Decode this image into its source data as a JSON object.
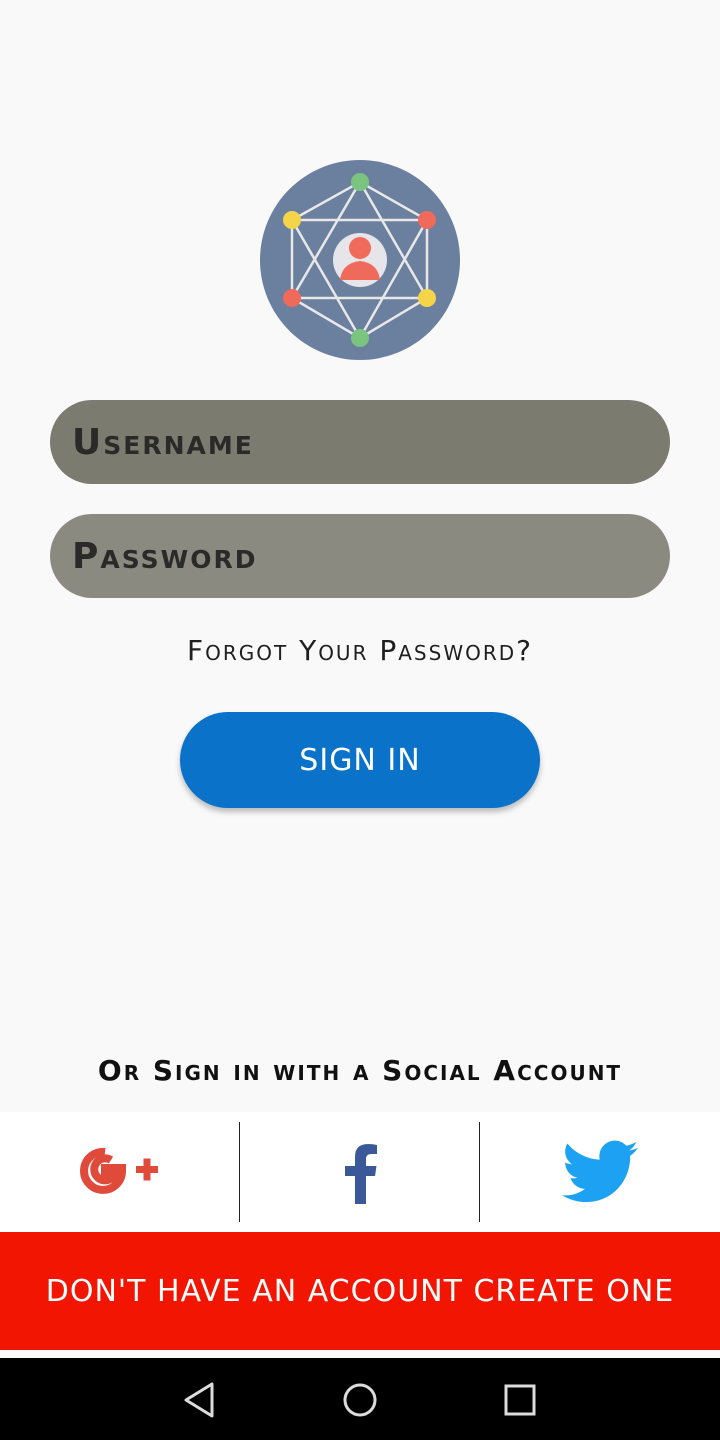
{
  "login": {
    "username_placeholder": "Username",
    "password_placeholder": "Password",
    "forgot_link": "Forgot Your Password?",
    "signin_label": "SIGN IN"
  },
  "social": {
    "title": "Or Sign in with a Social Account",
    "providers": [
      {
        "name": "google-plus",
        "icon": "google-plus-icon",
        "color": "#e04a3b"
      },
      {
        "name": "facebook",
        "icon": "facebook-icon",
        "color": "#3b5998"
      },
      {
        "name": "twitter",
        "icon": "twitter-icon",
        "color": "#1da1f2"
      }
    ]
  },
  "create_account_label": "DON'T HAVE AN ACCOUNT CREATE ONE",
  "colors": {
    "accent_blue": "#0a72c9",
    "cta_red": "#f21602",
    "logo_bg": "#6b7f9e"
  },
  "navbar": {
    "icons": [
      "back-icon",
      "home-icon",
      "recents-icon"
    ]
  }
}
